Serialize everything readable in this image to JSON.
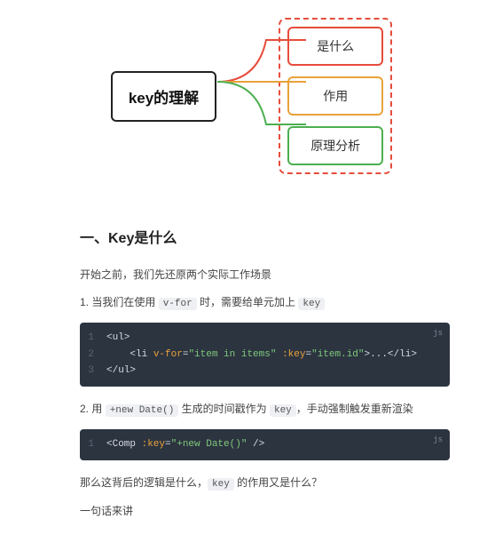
{
  "diagram": {
    "root": "key的理解",
    "children": [
      {
        "label": "是什么",
        "color": "red"
      },
      {
        "label": "作用",
        "color": "orange"
      },
      {
        "label": "原理分析",
        "color": "green"
      }
    ]
  },
  "article": {
    "heading": "一、Key是什么",
    "intro": "开始之前，我们先还原两个实际工作场景",
    "point1": {
      "prefix": "1. 当我们在使用 ",
      "code1": "v-for",
      "mid": " 时，需要给单元加上 ",
      "code2": "key"
    },
    "code1": {
      "lang": "js",
      "lines": [
        {
          "n": "1",
          "segments": [
            {
              "t": "<ul>",
              "c": "tag"
            }
          ]
        },
        {
          "n": "2",
          "segments": [
            {
              "t": "    <li ",
              "c": "tag"
            },
            {
              "t": "v-for",
              "c": "attr"
            },
            {
              "t": "=",
              "c": "tag"
            },
            {
              "t": "\"item in items\"",
              "c": "str"
            },
            {
              "t": " ",
              "c": "tag"
            },
            {
              "t": ":key",
              "c": "attr"
            },
            {
              "t": "=",
              "c": "tag"
            },
            {
              "t": "\"item.id\"",
              "c": "str"
            },
            {
              "t": ">...</li>",
              "c": "tag"
            }
          ]
        },
        {
          "n": "3",
          "segments": [
            {
              "t": "</ul>",
              "c": "tag"
            }
          ]
        }
      ]
    },
    "point2": {
      "prefix": "2. 用 ",
      "code1": "+new Date()",
      "mid": " 生成的时间戳作为 ",
      "code2": "key",
      "suffix": "，手动强制触发重新渲染"
    },
    "code2": {
      "lang": "js",
      "lines": [
        {
          "n": "1",
          "segments": [
            {
              "t": "<Comp ",
              "c": "tag"
            },
            {
              "t": ":key",
              "c": "attr"
            },
            {
              "t": "=",
              "c": "tag"
            },
            {
              "t": "\"+new Date()\"",
              "c": "str"
            },
            {
              "t": " />",
              "c": "tag"
            }
          ]
        }
      ]
    },
    "q": {
      "prefix": "那么这背后的逻辑是什么，",
      "code": "key",
      "suffix": " 的作用又是什么？"
    },
    "outro": "一句话来讲"
  }
}
